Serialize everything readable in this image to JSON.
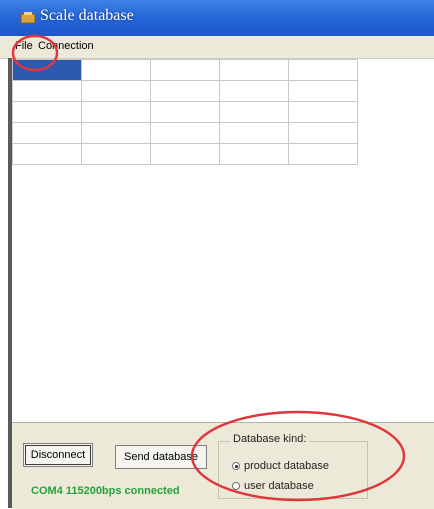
{
  "window": {
    "title": "Scale database"
  },
  "menu": {
    "file": "File",
    "connection": "Connection"
  },
  "grid": {
    "rows": 5,
    "columns": 5
  },
  "bottom": {
    "disconnect_label": "Disconnect",
    "send_label": "Send database",
    "status_text": "COM4 115200bps connected",
    "database_kind": {
      "legend": "Database kind:",
      "options": [
        "product database",
        "user database"
      ],
      "selected": "product database"
    }
  },
  "colors": {
    "titlebar": "#2566d8",
    "selected_cell": "#2d5ab0",
    "status_text": "#27a03a",
    "annotation": "#e0353a"
  }
}
